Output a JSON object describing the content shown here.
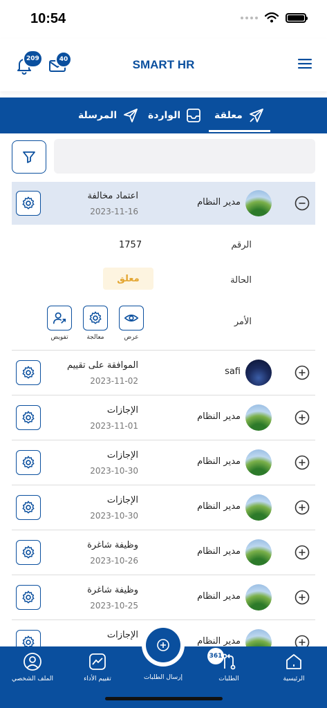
{
  "status_bar": {
    "time": "10:54"
  },
  "header": {
    "title": "SMART HR",
    "notifications_count": "209",
    "messages_count": "40"
  },
  "tabs": [
    {
      "label": "معلقة",
      "icon": "send-icon",
      "active": true
    },
    {
      "label": "الواردة",
      "icon": "inbox-icon",
      "active": false
    },
    {
      "label": "المرسلة",
      "icon": "paper-plane-icon",
      "active": false
    }
  ],
  "search": {
    "placeholder": ""
  },
  "expanded_request": {
    "title": "اعتماد مخالفة",
    "date": "2023-11-16",
    "sender": "مدير النظام",
    "number_label": "الرقم",
    "number_value": "1757",
    "status_label": "الحالة",
    "status_value": "معلق",
    "action_label": "الأمر",
    "actions": [
      {
        "label": "تفويض",
        "icon": "delegate-user-icon"
      },
      {
        "label": "معالجة",
        "icon": "gear-icon"
      },
      {
        "label": "عرض",
        "icon": "eye-icon"
      }
    ]
  },
  "requests": [
    {
      "title": "الموافقة على تقييم",
      "date": "2023-11-02",
      "sender": "safi",
      "avatar": "night"
    },
    {
      "title": "الإجازات",
      "date": "2023-11-01",
      "sender": "مدير النظام",
      "avatar": "landscape"
    },
    {
      "title": "الإجازات",
      "date": "2023-10-30",
      "sender": "مدير النظام",
      "avatar": "landscape"
    },
    {
      "title": "الإجازات",
      "date": "2023-10-30",
      "sender": "مدير النظام",
      "avatar": "landscape"
    },
    {
      "title": "وظيفة شاغرة",
      "date": "2023-10-26",
      "sender": "مدير النظام",
      "avatar": "landscape"
    },
    {
      "title": "وظيفة شاغرة",
      "date": "2023-10-25",
      "sender": "مدير النظام",
      "avatar": "landscape"
    },
    {
      "title": "الإجازات",
      "date": "",
      "sender": "مدير النظام",
      "avatar": "landscape"
    }
  ],
  "bottom_nav": {
    "profile": "الملف الشخصي",
    "performance": "تقييم الأداء",
    "send_requests": "إرسال الطلبات",
    "requests": "الطلبات",
    "requests_badge": "361",
    "home": "الرئيسية"
  },
  "colors": {
    "primary": "#0a4f9e",
    "expanded_row": "#dfe7f3",
    "pending": "#e3a530"
  }
}
